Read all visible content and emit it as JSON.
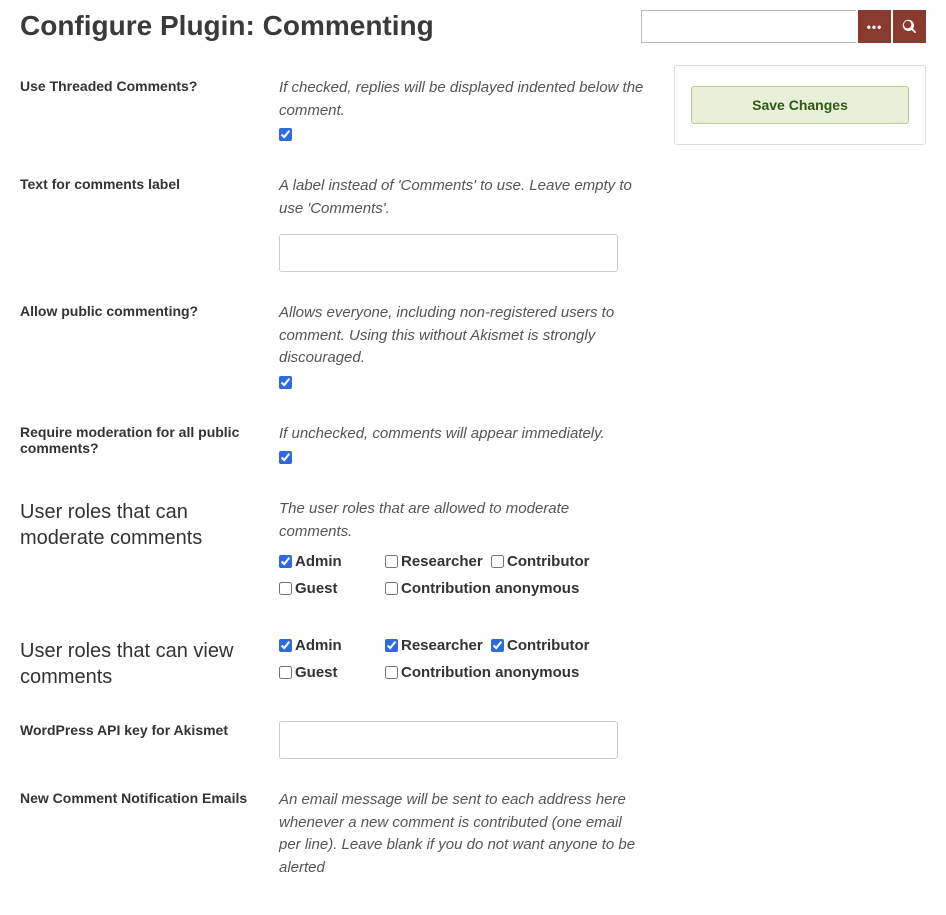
{
  "page_title": "Configure Plugin: Commenting",
  "save_button": "Save Changes",
  "fields": {
    "threaded": {
      "label": "Use Threaded Comments?",
      "hint": "If checked, replies will be displayed indented below the comment.",
      "checked": true
    },
    "text_label": {
      "label": "Text for comments label",
      "hint": "A label instead of 'Comments' to use. Leave empty to use 'Comments'.",
      "value": ""
    },
    "allow_public": {
      "label": "Allow public commenting?",
      "hint": "Allows everyone, including non-registered users to comment. Using this without Akismet is strongly discouraged.",
      "checked": true
    },
    "require_moderation": {
      "label": "Require moderation for all public comments?",
      "hint": "If unchecked, comments will appear immediately.",
      "checked": true
    },
    "roles_moderate": {
      "label": "User roles that can moderate comments",
      "hint": "The user roles that are allowed to moderate comments.",
      "roles": [
        {
          "name": "Admin",
          "checked": true
        },
        {
          "name": "Researcher",
          "checked": false
        },
        {
          "name": "Contributor",
          "checked": false
        },
        {
          "name": "Guest",
          "checked": false
        },
        {
          "name": "Contribution anonymous",
          "checked": false
        }
      ]
    },
    "roles_view": {
      "label": "User roles that can view comments",
      "roles": [
        {
          "name": "Admin",
          "checked": true
        },
        {
          "name": "Researcher",
          "checked": true
        },
        {
          "name": "Contributor",
          "checked": true
        },
        {
          "name": "Guest",
          "checked": false
        },
        {
          "name": "Contribution anonymous",
          "checked": false
        }
      ]
    },
    "akismet": {
      "label": "WordPress API key for Akismet",
      "value": ""
    },
    "notify_emails": {
      "label": "New Comment Notification Emails",
      "hint": "An email message will be sent to each address here whenever a new comment is contributed (one email per line). Leave blank if you do not want anyone to be alerted"
    }
  }
}
